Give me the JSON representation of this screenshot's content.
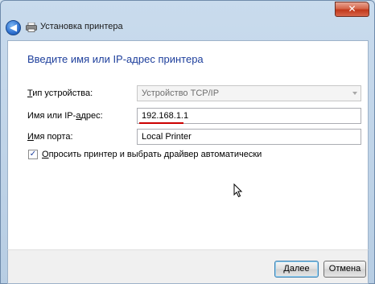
{
  "window": {
    "title": "Установка принтера",
    "close_glyph": "✕"
  },
  "nav": {
    "back_glyph": "◀"
  },
  "page": {
    "heading": "Введите имя или IP-адрес принтера"
  },
  "form": {
    "device_type": {
      "label_underlined": "Т",
      "label_rest": "ип устройства:",
      "value": "Устройство TCP/IP"
    },
    "host": {
      "label_pre": "Имя или IP-",
      "label_underlined": "а",
      "label_rest": "дрес:",
      "value": "192.168.1.1"
    },
    "port": {
      "label_underlined": "И",
      "label_rest": "мя порта:",
      "value": "Local Printer"
    },
    "auto_driver": {
      "checked_glyph": "✓",
      "label_underlined": "О",
      "label_rest": "просить принтер и выбрать драйвер автоматически"
    }
  },
  "buttons": {
    "next_underlined": "Д",
    "next_rest": "алее",
    "cancel": "Отмена"
  },
  "colors": {
    "heading": "#1e3f9c",
    "annotation_red": "#cc0000"
  }
}
